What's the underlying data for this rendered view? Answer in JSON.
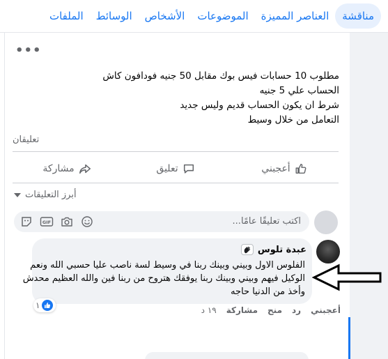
{
  "tabs": [
    {
      "label": "مناقشة",
      "active": true
    },
    {
      "label": "العناصر المميزة",
      "active": false
    },
    {
      "label": "الموضوعات",
      "active": false
    },
    {
      "label": "الأشخاص",
      "active": false
    },
    {
      "label": "الوسائط",
      "active": false
    },
    {
      "label": "الملفات",
      "active": false
    }
  ],
  "post": {
    "lines": [
      "مطلوب 10 حسابات فيس بوك مقابل 50 جنيه فودافون كاش",
      "الحساب علي 5 جنيه",
      "شرط ان يكون الحساب قديم وليس جديد",
      "التعامل من خلال وسيط"
    ],
    "comments_count_label": "تعليقان"
  },
  "actions": {
    "like": "أعجبني",
    "comment": "تعليق",
    "share": "مشاركة"
  },
  "sort_label": "أبرز التعليقات",
  "composer": {
    "placeholder": "اكتب تعليقًا عامًا..."
  },
  "comment": {
    "author": "عبدة تلوس",
    "lines": [
      "الفلوس الاول وبيني وبينك ربنا في وسيط لسة ناصب عليا حسبي الله ونعم",
      "الوكيل فيهم وبيني وبينك ربنا يوفقك هتروح من ربنا فين والله العظيم محدش",
      "وأخذ من الدنيا حاجه"
    ],
    "reaction_count": "١",
    "actions": {
      "like": "أعجبني",
      "reply": "رد",
      "gift": "منح",
      "share": "مشاركة",
      "time": "١٩ د"
    }
  },
  "colors": {
    "accent": "#1877f2",
    "secondary_text": "#65676b",
    "bubble_bg": "#f0f2f5"
  },
  "icons": {
    "more": "more-dots-icon",
    "like": "thumbs-up-icon",
    "comment": "speech-bubble-icon",
    "share": "share-arrow-icon",
    "sticker": "sticker-icon",
    "gif": "gif-icon",
    "camera": "camera-icon",
    "emoji": "emoji-icon"
  }
}
